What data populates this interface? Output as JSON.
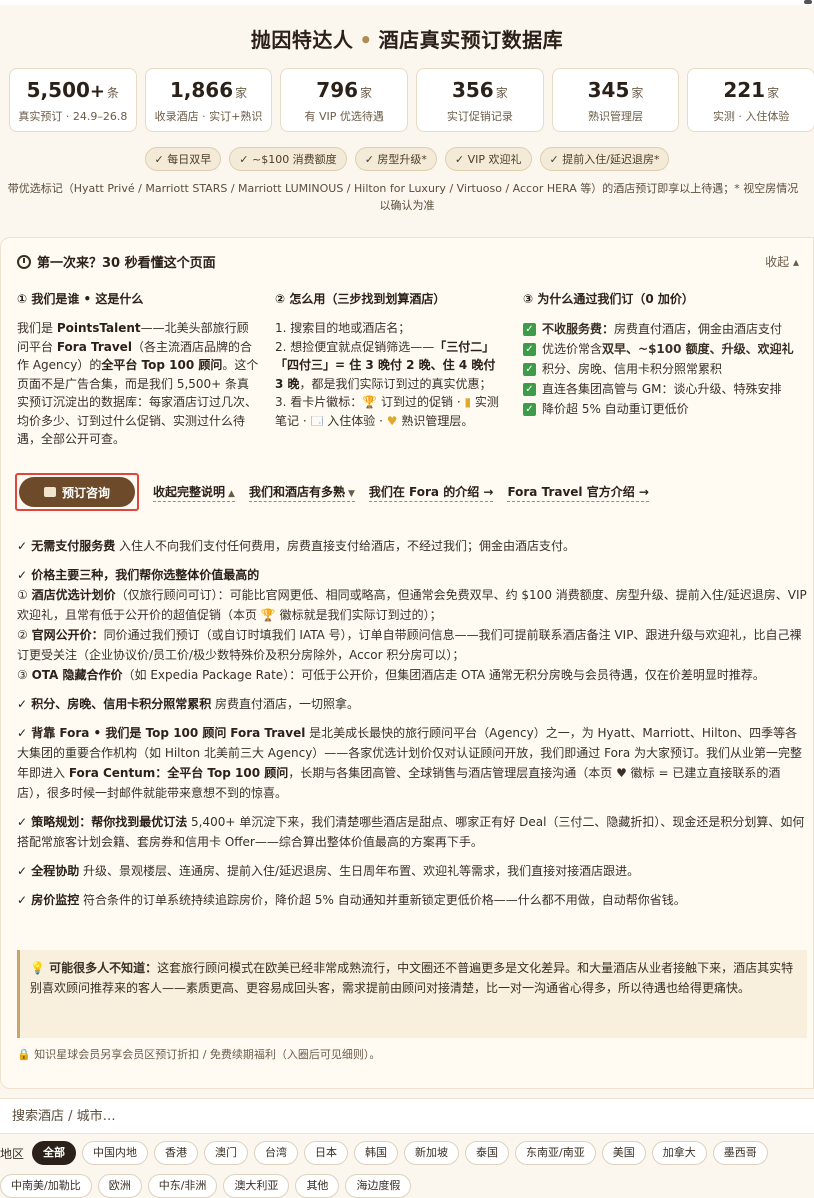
{
  "header": {
    "title_left": "抛因特达人",
    "title_sep": "•",
    "title_right": "酒店真实预订数据库"
  },
  "stats": [
    {
      "num": "5,500",
      "plus": "+",
      "unit": "条",
      "sub": "真实预订 · 24.9–26.8"
    },
    {
      "num": "1,866",
      "plus": "",
      "unit": "家",
      "sub": "收录酒店 · 实订+熟识"
    },
    {
      "num": "796",
      "plus": "",
      "unit": "家",
      "sub": "有 VIP 优选待遇"
    },
    {
      "num": "356",
      "plus": "",
      "unit": "家",
      "sub": "实订促销记录"
    },
    {
      "num": "345",
      "plus": "",
      "unit": "家",
      "sub": "熟识管理层"
    },
    {
      "num": "221",
      "plus": "",
      "unit": "家",
      "sub": "实测 · 入住体验"
    }
  ],
  "perks": [
    "✓ 每日双早",
    "✓ ~$100 消费额度",
    "✓ 房型升级*",
    "✓ VIP 欢迎礼",
    "✓ 提前入住/延迟退房*"
  ],
  "note": {
    "line1": "带优选标记（Hyatt Privé / Marriott STARS / Marriott LUMINOUS / Hilton for Luxury / Virtuoso / Accor HERA 等）的酒店预订即享以上待遇；* 视空房情况",
    "line2": "以确认为准"
  },
  "intro": {
    "title": "第一次来？30 秒看懂这个页面",
    "collapse": "收起 ▴",
    "col1": {
      "heading": "① 我们是谁 • 这是什么",
      "p1": "我们是 ",
      "b1": "PointsTalent",
      "p2": "——北美头部旅行顾问平台 ",
      "b2": "Fora Travel",
      "p3": "（各主流酒店品牌的合作 Agency）的",
      "b3": "全平台 Top 100 顾问",
      "p4": "。这个页面不是广告合集，而是我们 5,500+ 条真实预订沉淀出的数据库：每家酒店订过几次、均价多少、订到过什么促销、实测过什么待遇，全部公开可查。"
    },
    "col2": {
      "heading": "② 怎么用（三步找到划算酒店）",
      "s1": "1. 搜索目的地或酒店名；",
      "s2a": "2. 想捡便宜就点促销筛选——",
      "s2b": "「三付二」「四付三」= 住 3 晚付 2 晚、住 4 晚付 3 晚",
      "s2c": "，都是我们实际订到过的真实优惠；",
      "s3a": "3. 看卡片徽标：",
      "s3t": "🏆",
      "s3b": " 订到过的促销 · ",
      "s3c": "▮",
      "s3d": " 实测笔记 · ",
      "s3e": "🗔",
      "s3f": " 入住体验 · ",
      "s3g": "♥",
      "s3h": " 熟识管理层。"
    },
    "col3": {
      "heading": "③ 为什么通过我们订（0 加价）",
      "items": [
        {
          "bold": "不收服务费：",
          "text": "房费直付酒店，佣金由酒店支付"
        },
        {
          "bold": "",
          "text": "优选价常含",
          "bold2": "双早、~$100 额度、升级、欢迎礼"
        },
        {
          "bold": "",
          "text": "积分、房晚、信用卡积分照常累积"
        },
        {
          "bold": "",
          "text": "直连各集团高管与 GM：谈心升级、特殊安排"
        },
        {
          "bold": "",
          "text": "降价超 5% 自动重订更低价"
        }
      ]
    }
  },
  "actions": {
    "book": "预订咨询",
    "links": [
      "收起完整说明",
      "我们和酒店有多熟",
      "我们在 Fora 的介绍 →",
      "Fora Travel 官方介绍 →"
    ]
  },
  "details": {
    "b1": {
      "h": "✓ 无需支付服务费",
      "t": " 入住人不向我们支付任何费用，房费直接支付给酒店，不经过我们；佣金由酒店支付。"
    },
    "b2": {
      "h": "✓ 价格主要三种，我们帮你选整体价值最高的",
      "l1a": "① ",
      "l1b": "酒店优选计划价",
      "l1c": "（仅旅行顾问可订）：可能比官网更低、相同或略高，但通常会免费双早、约 $100 消费额度、房型升级、提前入住/延迟退房、VIP 欢迎礼，且常有低于公开价的超值促销（本页 🏆 徽标就是我们实际订到过的）；",
      "l2a": "② ",
      "l2b": "官网公开价：",
      "l2c": "同价通过我们预订（或自订时填我们 IATA 号），订单自带顾问信息——我们可提前联系酒店备注 VIP、跟进升级与欢迎礼，比自己裸订更受关注（企业协议价/员工价/极少数特殊价及积分房除外，Accor 积分房可以）；",
      "l3a": "③ ",
      "l3b": "OTA 隐藏合作价",
      "l3c": "（如 Expedia Package Rate）：可低于公开价，但集团酒店走 OTA 通常无积分房晚与会员待遇，仅在价差明显时推荐。"
    },
    "b3": {
      "h": "✓ 积分、房晚、信用卡积分照常累积",
      "t": " 房费直付酒店，一切照拿。"
    },
    "b4": {
      "h": "✓ 背靠 Fora • 我们是 Top 100 顾问",
      "a": "  ",
      "b": "Fora Travel",
      "c": " 是北美成长最快的旅行顾问平台（Agency）之一，为 Hyatt、Marriott、Hilton、四季等各大集团的重要合作机构（如 Hilton 北美前三大 Agency）——各家优选计划价仅对认证顾问开放，我们即通过 Fora 为大家预订。我们从业第一完整年即进入 ",
      "d": "Fora Centum：全平台 Top 100 顾问",
      "e": "，长期与各集团高管、全球销售与酒店管理层直接沟通（本页 ♥ 徽标 = 已建立直接联系的酒店），很多时候一封邮件就能带来意想不到的惊喜。"
    },
    "b5": {
      "h": "✓ 策略规划：帮你找到最优订法",
      "t": " 5,400+ 单沉淀下来，我们清楚哪些酒店是甜点、哪家正有好 Deal（三付二、隐藏折扣）、现金还是积分划算、如何搭配常旅客计划会籍、套房券和信用卡 Offer——综合算出整体价值最高的方案再下手。"
    },
    "b6": {
      "h": "✓ 全程协助",
      "t": " 升级、景观楼层、连通房、提前入住/延迟退房、生日周年布置、欢迎礼等需求，我们直接对接酒店跟进。"
    },
    "b7": {
      "h": "✓ 房价监控",
      "t": " 符合条件的订单系统持续追踪房价，降价超 5% 自动通知并重新锁定更低价格——什么都不用做，自动帮你省钱。"
    }
  },
  "tip": {
    "h": "💡 可能很多人不知道：",
    "t": "这套旅行顾问模式在欧美已经非常成熟流行，中文圈还不普遍更多是文化差异。和大量酒店从业者接触下来，酒店其实特别喜欢顾问推荐来的客人——素质更高、更容易成回头客，需求提前由顾问对接清楚，比一对一沟通省心得多，所以待遇也给得更痛快。"
  },
  "footnote": "🔒 知识星球会员另享会员区预订折扣 / 免费续期福利（入圈后可见细则）。",
  "search": {
    "placeholder": "搜索酒店 / 城市…"
  },
  "regions": {
    "label": "地区",
    "row1": [
      "全部",
      "中国内地",
      "香港",
      "澳门",
      "台湾",
      "日本",
      "韩国",
      "新加坡",
      "泰国",
      "东南亚/南亚",
      "美国",
      "加拿大",
      "墨西哥"
    ],
    "row2": [
      "中南美/加勒比",
      "欧洲",
      "中东/非洲",
      "澳大利亚",
      "其他",
      "海边度假"
    ]
  }
}
